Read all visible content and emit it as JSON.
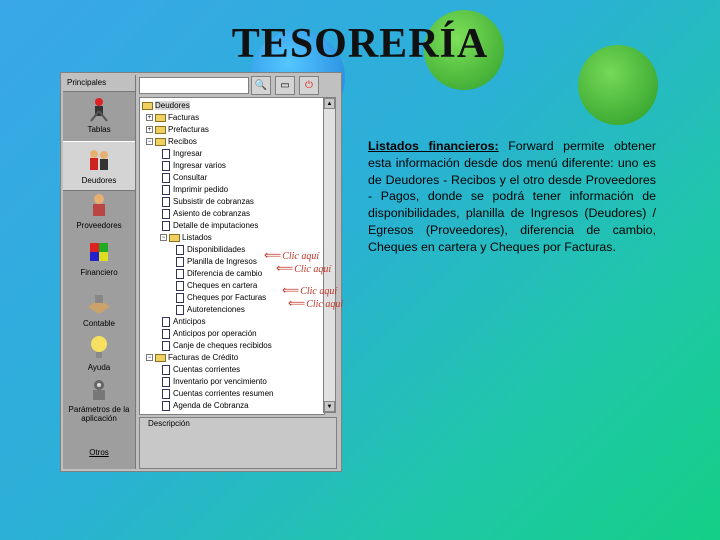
{
  "slide": {
    "title": "TESORERÍA",
    "description_label": "Listados financieros:",
    "description_text": " Forward permite obtener esta información desde dos menú diferente: uno es de Deudores - Recibos y el otro desde Proveedores - Pagos, donde se podrá tener información de disponibilidades, planilla de Ingresos (Deudores) / Egresos (Proveedores), diferencia de cambio, Cheques en cartera y Cheques por Facturas."
  },
  "app": {
    "sidebar_header": "Principales",
    "sidebar_items": [
      {
        "label": "Tablas",
        "icon": "tables-icon"
      },
      {
        "label": "Deudores",
        "icon": "debtors-icon"
      },
      {
        "label": "Proveedores",
        "icon": "suppliers-icon"
      },
      {
        "label": "Financiero",
        "icon": "financial-icon"
      },
      {
        "label": "Contable",
        "icon": "accounting-icon"
      },
      {
        "label": "Ayuda",
        "icon": "help-icon"
      },
      {
        "label": "Parámetros de la aplicación",
        "icon": "settings-icon"
      }
    ],
    "sidebar_footer": "Otros",
    "tree": [
      {
        "label": "Deudores",
        "type": "folder"
      },
      {
        "label": "Facturas",
        "type": "folder"
      },
      {
        "label": "Prefacturas",
        "type": "folder"
      },
      {
        "label": "Recibos",
        "type": "folder"
      },
      {
        "label": "Ingresar",
        "type": "doc"
      },
      {
        "label": "Ingresar varios",
        "type": "doc"
      },
      {
        "label": "Consultar",
        "type": "doc"
      },
      {
        "label": "Imprimir pedido",
        "type": "doc"
      },
      {
        "label": "Subsistir de cobranzas",
        "type": "doc"
      },
      {
        "label": "Asiento de cobranzas",
        "type": "doc"
      },
      {
        "label": "Detalle de imputaciones",
        "type": "doc"
      },
      {
        "label": "Listados",
        "type": "folder"
      },
      {
        "label": "Disponibilidades",
        "type": "doc"
      },
      {
        "label": "Planilla de Ingresos",
        "type": "doc"
      },
      {
        "label": "Diferencia de cambio",
        "type": "doc"
      },
      {
        "label": "Cheques en cartera",
        "type": "doc"
      },
      {
        "label": "Cheques por Facturas",
        "type": "doc"
      },
      {
        "label": "Autoretenciones",
        "type": "doc"
      },
      {
        "label": "Anticipos",
        "type": "doc"
      },
      {
        "label": "Anticipos por operación",
        "type": "doc"
      },
      {
        "label": "Canje de cheques recibidos",
        "type": "doc"
      },
      {
        "label": "Facturas de Crédito",
        "type": "folder"
      },
      {
        "label": "Cuentas corrientes",
        "type": "doc"
      },
      {
        "label": "Inventario por vencimiento",
        "type": "doc"
      },
      {
        "label": "Cuentas corrientes resumen",
        "type": "doc"
      },
      {
        "label": "Agenda de Cobranza",
        "type": "doc"
      }
    ],
    "description_panel": "Descripción",
    "callout": "Clic aquí"
  },
  "colors": {
    "callout": "#c0362a",
    "folder": "#f0d060"
  }
}
